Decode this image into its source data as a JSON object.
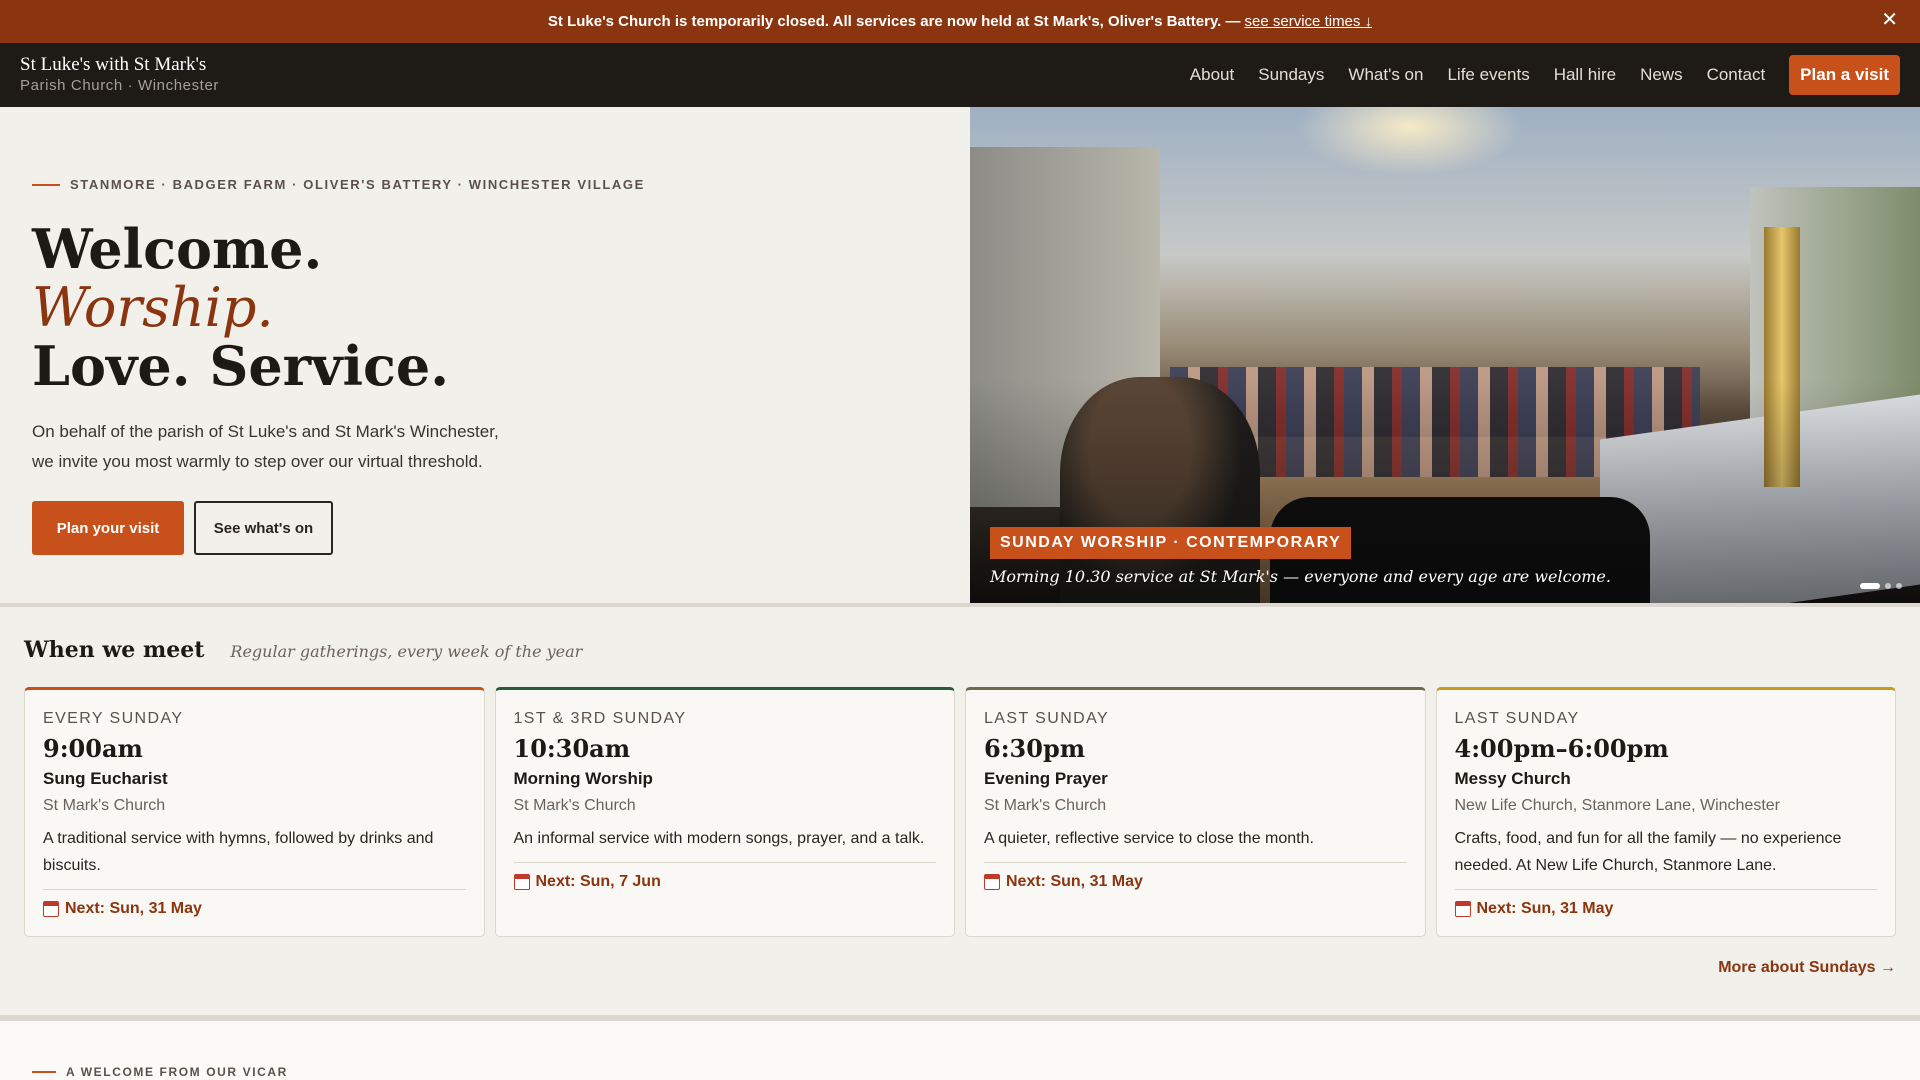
{
  "announcement": {
    "text": "St Luke's Church is temporarily closed. All services are now held at St Mark's, Oliver's Battery. —",
    "link": "see service times ↓",
    "close_glyph": "✕"
  },
  "header": {
    "brand_name": "St Luke's with St Mark's",
    "brand_sub": "Parish Church · Winchester",
    "nav": [
      "About",
      "Sundays",
      "What's on",
      "Life events",
      "Hall hire",
      "News",
      "Contact"
    ],
    "cta": "Plan a visit"
  },
  "hero": {
    "eyebrow": "STANMORE · BADGER FARM · OLIVER'S BATTERY · WINCHESTER VILLAGE",
    "line1": "Welcome.",
    "line2": "Worship.",
    "line3": "Love. Service.",
    "lead": "On behalf of the parish of St Luke's and St Mark's Winchester, we invite you most warmly to step over our virtual threshold.",
    "primary_button": "Plan your visit",
    "secondary_button": "See what's on",
    "caption_tag": "SUNDAY WORSHIP · CONTEMPORARY",
    "caption_text": "Morning 10.30 service at St Mark's — everyone and every age are welcome.",
    "slides_total": 3,
    "slide_active": 1
  },
  "meet": {
    "title": "When we meet",
    "subtitle": "Regular gatherings, every week of the year",
    "cards": [
      {
        "when": "EVERY SUNDAY",
        "time": "9:00am",
        "name": "Sung Eucharist",
        "location": "St Mark's Church",
        "description": "A traditional service with hymns, followed by drinks and biscuits.",
        "next": "Next: Sun, 31 May",
        "accent": "#c8501a"
      },
      {
        "when": "1ST & 3RD SUNDAY",
        "time": "10:30am",
        "name": "Morning Worship",
        "location": "St Mark's Church",
        "description": "An informal service with modern songs, prayer, and a talk.",
        "next": "Next: Sun, 7 Jun",
        "accent": "#2a5a3a"
      },
      {
        "when": "LAST SUNDAY",
        "time": "6:30pm",
        "name": "Evening Prayer",
        "location": "St Mark's Church",
        "description": "A quieter, reflective service to close the month.",
        "next": "Next: Sun, 31 May",
        "accent": "#6d6a4d"
      },
      {
        "when": "LAST SUNDAY",
        "time": "4:00pm–6:00pm",
        "name": "Messy Church",
        "location": "New Life Church, Stanmore Lane, Winchester",
        "description": "Crafts, food, and fun for all the family — no experience needed. At New Life Church, Stanmore Lane.",
        "next": "Next: Sun, 31 May",
        "accent": "#c59b1b"
      }
    ],
    "more_link": "More about Sundays →"
  },
  "vicar": {
    "eyebrow": "A WELCOME FROM OUR VICAR"
  },
  "colors": {
    "brand": "#c8501a",
    "announce_bg": "#8a3510",
    "header_bg": "#1e1b17",
    "page_bg": "#f2f0eb"
  }
}
